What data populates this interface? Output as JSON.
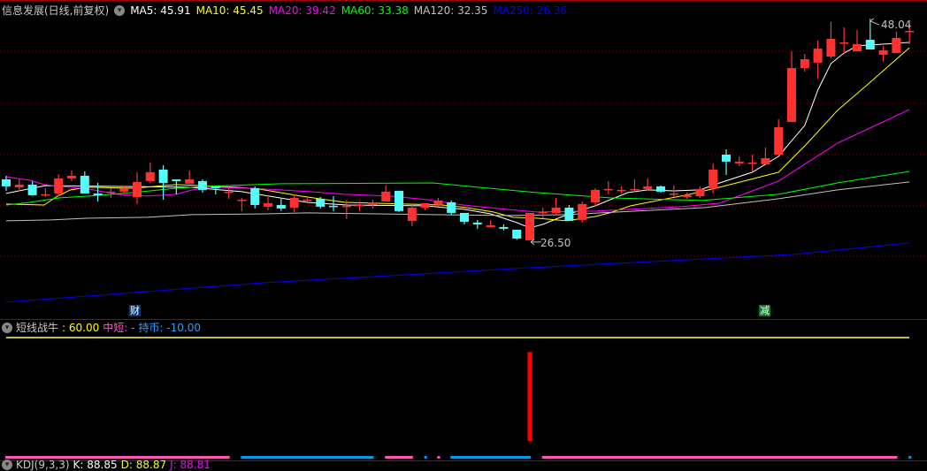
{
  "header": {
    "title": "信息发展(日线,前复权)",
    "ma": [
      {
        "label": "MA5: 45.91",
        "color": "#ffffff"
      },
      {
        "label": "MA10: 45.45",
        "color": "#ffff00"
      },
      {
        "label": "MA20: 39.42",
        "color": "#ff00ff"
      },
      {
        "label": "MA60: 33.38",
        "color": "#00ff00"
      },
      {
        "label": "MA120: 32.35",
        "color": "#c0c0c0"
      },
      {
        "label": "MA250: 26.36",
        "color": "#0000ff"
      }
    ]
  },
  "markers": {
    "cai": "财",
    "jian": "减",
    "high_label": "48.04",
    "low_label": "26.50"
  },
  "indicator": {
    "name": "短线战牛",
    "value": ": 60.00",
    "mid_label": "中短: -",
    "hold_label": "持币: -10.00"
  },
  "kdj": {
    "name": "KDJ(9,3,3)",
    "k": "K: 88.85",
    "d": "D: 88.87",
    "j": "J: 88.81"
  },
  "chart_data": {
    "type": "candlestick",
    "title": "信息发展(日线,前复权)",
    "colors": {
      "up": "#ff3232",
      "down": "#54fcfc"
    },
    "price_range": [
      20.15,
      50.12
    ],
    "ohlc": [
      [
        32.49,
        32.84,
        31.36,
        31.8
      ],
      [
        31.71,
        32.49,
        31.28,
        31.97
      ],
      [
        31.97,
        32.32,
        30.93,
        30.93
      ],
      [
        31.02,
        31.62,
        30.75,
        31.02
      ],
      [
        31.1,
        33.01,
        30.84,
        32.58
      ],
      [
        32.58,
        33.36,
        32.32,
        32.84
      ],
      [
        32.84,
        33.27,
        31.1,
        31.1
      ],
      [
        31.1,
        32.14,
        30.32,
        30.93
      ],
      [
        31.28,
        31.62,
        30.67,
        31.28
      ],
      [
        31.28,
        31.88,
        31.1,
        31.62
      ],
      [
        30.75,
        33.19,
        30.06,
        32.23
      ],
      [
        32.32,
        34.14,
        32.14,
        33.19
      ],
      [
        33.45,
        33.88,
        30.49,
        32.14
      ],
      [
        32.49,
        32.49,
        31.02,
        32.32
      ],
      [
        32.06,
        33.36,
        32.06,
        32.49
      ],
      [
        32.32,
        32.49,
        31.19,
        31.45
      ],
      [
        31.8,
        31.8,
        31.02,
        31.62
      ],
      [
        31.28,
        31.62,
        30.58,
        31.28
      ],
      [
        30.49,
        30.67,
        29.37,
        30.49
      ],
      [
        31.62,
        31.8,
        29.62,
        29.97
      ],
      [
        29.8,
        30.93,
        29.45,
        30.15
      ],
      [
        29.97,
        30.58,
        29.37,
        29.62
      ],
      [
        29.71,
        31.02,
        29.28,
        30.67
      ],
      [
        30.49,
        30.75,
        30.23,
        30.49
      ],
      [
        30.58,
        30.75,
        29.62,
        29.8
      ],
      [
        29.89,
        30.84,
        29.37,
        29.8
      ],
      [
        29.89,
        30.49,
        28.59,
        29.89
      ],
      [
        29.89,
        30.32,
        29.37,
        29.97
      ],
      [
        29.97,
        30.49,
        29.62,
        30.23
      ],
      [
        30.32,
        31.88,
        30.32,
        31.28
      ],
      [
        31.36,
        31.36,
        29.28,
        29.37
      ],
      [
        28.41,
        29.97,
        27.89,
        29.71
      ],
      [
        29.71,
        30.15,
        29.45,
        30.15
      ],
      [
        30.06,
        30.67,
        29.8,
        30.41
      ],
      [
        30.23,
        30.41,
        29.02,
        29.19
      ],
      [
        29.19,
        29.19,
        28.06,
        28.32
      ],
      [
        28.24,
        28.5,
        27.63,
        28.06
      ],
      [
        27.8,
        28.5,
        27.8,
        27.98
      ],
      [
        27.8,
        28.06,
        27.46,
        27.63
      ],
      [
        27.54,
        27.54,
        26.55,
        26.67
      ],
      [
        26.5,
        29.19,
        26.5,
        29.19
      ],
      [
        29.19,
        29.71,
        28.67,
        29.28
      ],
      [
        29.19,
        30.67,
        28.93,
        29.71
      ],
      [
        29.71,
        29.97,
        28.41,
        28.41
      ],
      [
        28.5,
        30.32,
        28.24,
        30.06
      ],
      [
        30.23,
        31.62,
        29.89,
        31.45
      ],
      [
        31.54,
        32.32,
        31.02,
        31.54
      ],
      [
        31.45,
        31.8,
        31.1,
        31.45
      ],
      [
        31.54,
        32.49,
        31.19,
        31.54
      ],
      [
        31.54,
        32.58,
        31.36,
        31.8
      ],
      [
        31.8,
        31.88,
        31.19,
        31.28
      ],
      [
        31.1,
        31.88,
        30.75,
        31.1
      ],
      [
        30.75,
        31.19,
        30.58,
        30.93
      ],
      [
        30.84,
        31.8,
        30.67,
        31.54
      ],
      [
        31.62,
        34.06,
        31.1,
        33.45
      ],
      [
        34.92,
        35.44,
        32.92,
        34.23
      ],
      [
        34.06,
        34.75,
        33.79,
        34.23
      ],
      [
        34.14,
        34.92,
        33.27,
        34.14
      ],
      [
        33.97,
        35.62,
        33.97,
        34.57
      ],
      [
        34.92,
        38.4,
        34.92,
        37.61
      ],
      [
        38.14,
        45.08,
        38.14,
        43.43
      ],
      [
        43.43,
        44.82,
        43.09,
        44.3
      ],
      [
        43.96,
        46.13,
        42.39,
        45.34
      ],
      [
        44.56,
        47.95,
        44.39,
        46.3
      ],
      [
        45.95,
        47.43,
        44.91,
        45.95
      ],
      [
        45.08,
        47.17,
        45.08,
        45.78
      ],
      [
        46.21,
        48.04,
        45.26,
        45.26
      ],
      [
        44.74,
        45.61,
        44.04,
        45.17
      ],
      [
        44.91,
        46.99,
        44.91,
        46.39
      ],
      [
        47.08,
        47.78,
        45.78,
        47.08
      ]
    ],
    "ma_series": [
      {
        "name": "MA5",
        "color": "#ffffff",
        "points": [
          [
            0,
            31.1
          ],
          [
            3,
            31.88
          ],
          [
            8,
            31.8
          ],
          [
            14,
            31.71
          ],
          [
            18,
            31.28
          ],
          [
            23,
            30.23
          ],
          [
            26,
            29.97
          ],
          [
            32,
            29.89
          ],
          [
            35,
            29.54
          ],
          [
            37,
            29.1
          ],
          [
            39,
            28.24
          ],
          [
            40,
            27.72
          ],
          [
            41,
            28.06
          ],
          [
            43,
            29.1
          ],
          [
            45,
            29.89
          ],
          [
            47.5,
            31.19
          ],
          [
            49,
            31.45
          ],
          [
            51,
            31.36
          ],
          [
            53,
            31.45
          ],
          [
            54.5,
            32.14
          ],
          [
            57,
            33.19
          ],
          [
            59,
            34.75
          ],
          [
            59.5,
            35.53
          ],
          [
            61,
            37.79
          ],
          [
            62,
            41.26
          ],
          [
            63,
            43.87
          ],
          [
            64,
            44.91
          ],
          [
            65,
            45.61
          ],
          [
            69,
            45.95
          ]
        ]
      },
      {
        "name": "MA10",
        "color": "#ffff00",
        "points": [
          [
            0,
            30.06
          ],
          [
            2.9,
            29.97
          ],
          [
            3.8,
            30.75
          ],
          [
            4.9,
            31.45
          ],
          [
            6.3,
            31.71
          ],
          [
            9.7,
            31.62
          ],
          [
            13,
            31.97
          ],
          [
            17.6,
            31.71
          ],
          [
            19.3,
            31.54
          ],
          [
            22.5,
            30.84
          ],
          [
            25.9,
            30.23
          ],
          [
            30.4,
            30.06
          ],
          [
            33.3,
            29.97
          ],
          [
            35.1,
            29.71
          ],
          [
            37.2,
            29.28
          ],
          [
            38.7,
            28.76
          ],
          [
            40.5,
            28.67
          ],
          [
            42.8,
            28.41
          ],
          [
            45,
            28.84
          ],
          [
            46.1,
            29.19
          ],
          [
            47.7,
            29.89
          ],
          [
            52.2,
            31.02
          ],
          [
            54.5,
            31.71
          ],
          [
            59,
            33.19
          ],
          [
            61.2,
            36.05
          ],
          [
            63.5,
            39.27
          ],
          [
            65.7,
            41.7
          ],
          [
            69,
            45.43
          ]
        ]
      },
      {
        "name": "MA20",
        "color": "#ff00ff",
        "points": [
          [
            0,
            32.75
          ],
          [
            1.8,
            32.4
          ],
          [
            2.9,
            31.97
          ],
          [
            4.1,
            31.8
          ],
          [
            6.3,
            31.54
          ],
          [
            8.5,
            31.02
          ],
          [
            10.8,
            30.84
          ],
          [
            13,
            31.02
          ],
          [
            14.2,
            31.45
          ],
          [
            15.7,
            31.71
          ],
          [
            18.7,
            31.62
          ],
          [
            20.9,
            31.45
          ],
          [
            23.2,
            31.28
          ],
          [
            25.9,
            31.02
          ],
          [
            29.3,
            30.84
          ],
          [
            32.2,
            30.49
          ],
          [
            34.9,
            29.97
          ],
          [
            38.2,
            29.54
          ],
          [
            40.5,
            29.28
          ],
          [
            45,
            29.37
          ],
          [
            51.6,
            29.8
          ],
          [
            54.5,
            30.15
          ],
          [
            59,
            32.32
          ],
          [
            63.5,
            36.05
          ],
          [
            69,
            39.35
          ]
        ]
      },
      {
        "name": "MA60",
        "color": "#00ff00",
        "points": [
          [
            0,
            29.97
          ],
          [
            1.8,
            30.23
          ],
          [
            4.1,
            30.67
          ],
          [
            6.3,
            30.84
          ],
          [
            9.7,
            31.19
          ],
          [
            13,
            31.62
          ],
          [
            15.3,
            31.8
          ],
          [
            21,
            32.06
          ],
          [
            32.6,
            32.14
          ],
          [
            36,
            31.71
          ],
          [
            40.5,
            31.19
          ],
          [
            46.1,
            30.67
          ],
          [
            53.1,
            30.41
          ],
          [
            59,
            31.02
          ],
          [
            63.5,
            32.14
          ],
          [
            69,
            33.27
          ]
        ]
      },
      {
        "name": "MA120",
        "color": "#c0c0c0",
        "points": [
          [
            0,
            28.41
          ],
          [
            3.4,
            28.5
          ],
          [
            6.3,
            28.67
          ],
          [
            10.8,
            28.76
          ],
          [
            14.2,
            29.02
          ],
          [
            19.8,
            29.1
          ],
          [
            23,
            29.19
          ],
          [
            32.6,
            29.02
          ],
          [
            38.2,
            28.93
          ],
          [
            42.8,
            29.02
          ],
          [
            53.4,
            29.71
          ],
          [
            59,
            30.58
          ],
          [
            63.5,
            31.45
          ],
          [
            69,
            32.23
          ]
        ]
      },
      {
        "name": "MA250",
        "color": "#0000ff",
        "points": [
          [
            0,
            20.42
          ],
          [
            19.8,
            22.33
          ],
          [
            40.1,
            23.81
          ],
          [
            60.3,
            25.12
          ],
          [
            69,
            26.24
          ]
        ]
      }
    ],
    "signal_bar": {
      "index": 40,
      "value": 60.0,
      "range": [
        -10,
        70
      ],
      "color": "#ff0000"
    },
    "state_segments": [
      {
        "from": 0,
        "to": 17,
        "color": "#ff55b4"
      },
      {
        "from": 18,
        "to": 28,
        "color": "#0896e8"
      },
      {
        "from": 29,
        "to": 31,
        "color": "#ff55b4"
      },
      {
        "from": 32,
        "to": 32,
        "color": "#0896e8"
      },
      {
        "from": 33,
        "to": 33,
        "color": "#ff55b4"
      },
      {
        "from": 34,
        "to": 40,
        "color": "#0896e8"
      },
      {
        "from": 41,
        "to": 68,
        "color": "#ff55b4"
      },
      {
        "from": 69,
        "to": 69,
        "color": "#0896e8"
      }
    ],
    "markers": [
      {
        "index": 10,
        "text_key": "cai"
      },
      {
        "index": 58,
        "text_key": "jian"
      }
    ],
    "extremes": {
      "high": {
        "index": 66,
        "value": 48.04
      },
      "low": {
        "index": 40,
        "value": 26.5
      }
    }
  }
}
